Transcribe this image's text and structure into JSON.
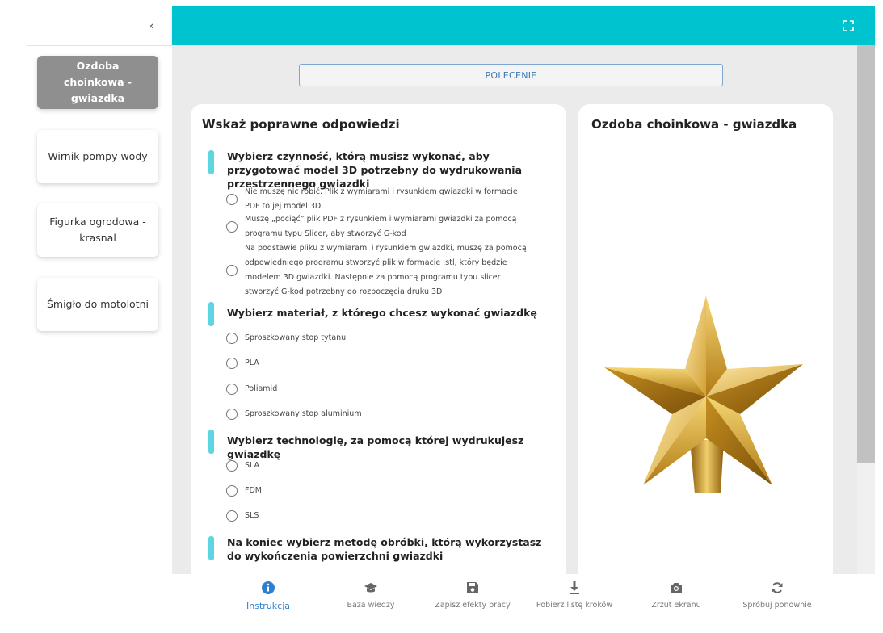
{
  "sidebar": {
    "items": [
      {
        "label": "Ozdoba choinkowa - gwiazdka",
        "active": true
      },
      {
        "label": "Wirnik pompy wody",
        "active": false
      },
      {
        "label": "Figurka ogrodowa - krasnal",
        "active": false
      },
      {
        "label": "Śmigło do motolotni",
        "active": false
      }
    ]
  },
  "colors": {
    "topbar": "#00c3d0",
    "accent_bar": "#5ed6e2",
    "active_sidebar": "#8f8f8f",
    "active_tab": "#2f7fd0"
  },
  "main": {
    "polecenie_label": "POLECENIE",
    "quiz": {
      "title": "Wskaż poprawne odpowiedzi",
      "questions": [
        {
          "text": "Wybierz czynność, którą musisz wykonać, aby przygotować model 3D potrzebny do wydrukowania przestrzennego gwiazdki",
          "options": [
            "Nie muszę nic robić. Plik z wymiarami i rysunkiem gwiazdki w formacie PDF to jej model 3D",
            "Muszę „pociąć” plik PDF z rysunkiem i wymiarami gwiazdki za pomocą programu typu Slicer, aby stworzyć G-kod",
            "Na podstawie pliku z wymiarami i rysunkiem gwiazdki, muszę za pomocą odpowiedniego programu stworzyć plik w formacie .stl, który będzie modelem 3D gwiazdki. Następnie za pomocą programu typu slicer stworzyć G-kod potrzebny do rozpoczęcia druku 3D"
          ]
        },
        {
          "text": "Wybierz materiał, z którego chcesz wykonać gwiazdkę",
          "options": [
            "Sproszkowany stop tytanu",
            "PLA",
            "Poliamid",
            "Sproszkowany stop aluminium"
          ]
        },
        {
          "text": "Wybierz technologię, za pomocą której wydrukujesz gwiazdkę",
          "options": [
            "SLA",
            "FDM",
            "SLS"
          ]
        },
        {
          "text": "Na koniec wybierz metodę obróbki, którą wykorzystasz do wykończenia powierzchni gwiazdki",
          "options": []
        }
      ]
    },
    "image_card": {
      "title": "Ozdoba choinkowa - gwiazdka",
      "image_icon": "gold-star-ornament"
    }
  },
  "bottombar": {
    "items": [
      {
        "label": "Instrukcja",
        "icon": "info-icon",
        "active": true
      },
      {
        "label": "Baza wiedzy",
        "icon": "graduation-cap-icon",
        "active": false
      },
      {
        "label": "Zapisz efekty pracy",
        "icon": "save-icon",
        "active": false
      },
      {
        "label": "Pobierz listę kroków",
        "icon": "download-icon",
        "active": false
      },
      {
        "label": "Zrzut ekranu",
        "icon": "camera-icon",
        "active": false
      },
      {
        "label": "Spróbuj ponownie",
        "icon": "refresh-icon",
        "active": false
      }
    ]
  }
}
